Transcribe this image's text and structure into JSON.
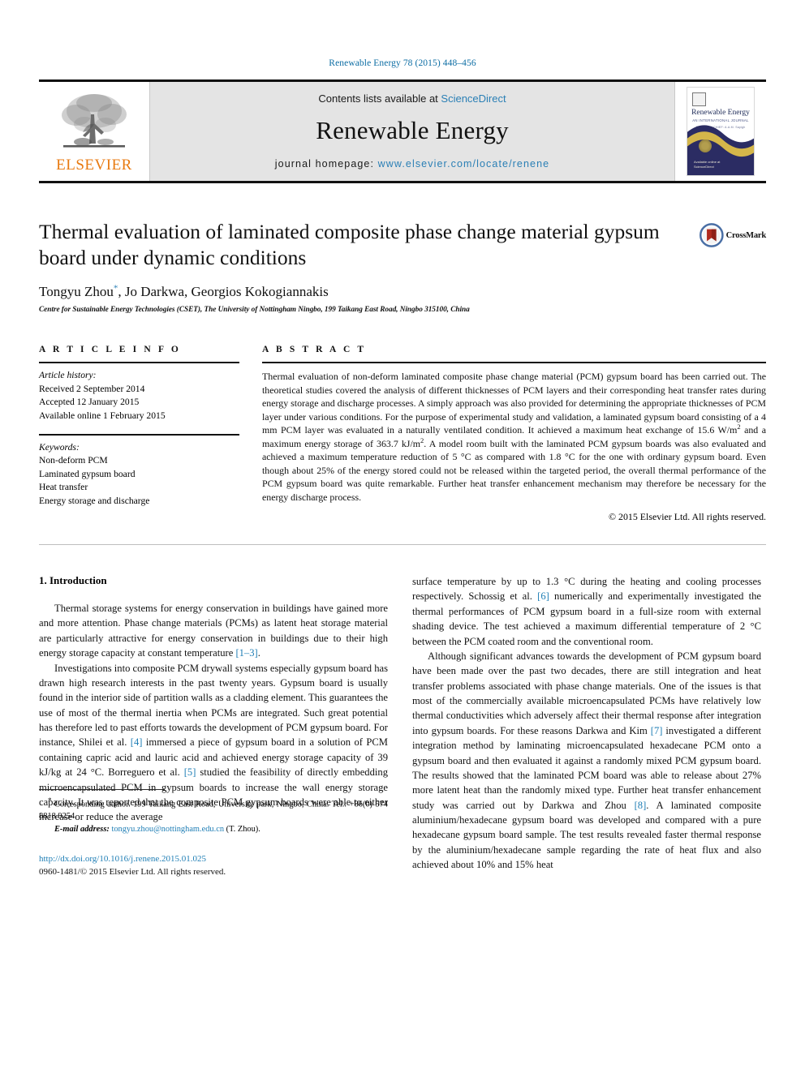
{
  "running_head": "Renewable Energy 78 (2015) 448–456",
  "masthead": {
    "publisher_logo_text": "ELSEVIER",
    "contents_prefix": "Contents lists available at ",
    "contents_link": "ScienceDirect",
    "journal_title": "Renewable Energy",
    "homepage_prefix": "journal homepage: ",
    "homepage_url": "www.elsevier.com/locate/renene",
    "cover": {
      "name": "Renewable Energy",
      "subtitle": "AN INTERNATIONAL JOURNAL",
      "subtitle2": "EDITOR-IN-CHIEF: A.A.M. Sayigh",
      "footer": "Available online at\nScienceDirect"
    }
  },
  "article": {
    "title": "Thermal evaluation of laminated composite phase change material gypsum board under dynamic conditions",
    "authors": "Tongyu Zhou, Jo Darkwa, Georgios Kokogiannakis",
    "affiliation": "Centre for Sustainable Energy Technologies (CSET), The University of Nottingham Ningbo, 199 Taikang East Road, Ningbo 315100, China",
    "crossmark_label": "CrossMark"
  },
  "article_info": {
    "heading": "A R T I C L E   I N F O",
    "history_label": "Article history:",
    "history": [
      "Received 2 September 2014",
      "Accepted 12 January 2015",
      "Available online 1 February 2015"
    ],
    "keywords_label": "Keywords:",
    "keywords": [
      "Non-deform PCM",
      "Laminated gypsum board",
      "Heat transfer",
      "Energy storage and discharge"
    ]
  },
  "abstract": {
    "heading": "A B S T R A C T",
    "part1": "Thermal evaluation of non-deform laminated composite phase change material (PCM) gypsum board has been carried out. The theoretical studies covered the analysis of different thicknesses of PCM layers and their corresponding heat transfer rates during energy storage and discharge processes. A simply approach was also provided for determining the appropriate thicknesses of PCM layer under various conditions. For the purpose of experimental study and validation, a laminated gypsum board consisting of a 4 mm PCM layer was evaluated in a naturally ventilated condition. It achieved a maximum heat exchange of 15.6 W/m",
    "sup1": "2",
    "part2": " and a maximum energy storage of 363.7 kJ/m",
    "sup2": "2",
    "part3": ". A model room built with the laminated PCM gypsum boards was also evaluated and achieved a maximum temperature reduction of 5 °C as compared with 1.8 °C for the one with ordinary gypsum board. Even though about 25% of the energy stored could not be released within the targeted period, the overall thermal performance of the PCM gypsum board was quite remarkable. Further heat transfer enhancement mechanism may therefore be necessary for the energy discharge process.",
    "copyright": "© 2015 Elsevier Ltd. All rights reserved."
  },
  "introduction": {
    "heading": "1. Introduction",
    "left": {
      "p1_a": "Thermal storage systems for energy conservation in buildings have gained more and more attention. Phase change materials (PCMs) as latent heat storage material are particularly attractive for energy conservation in buildings due to their high energy storage capacity at constant temperature ",
      "p1_ref": "[1–3]",
      "p1_b": ".",
      "p2_a": "Investigations into composite PCM drywall systems especially gypsum board has drawn high research interests in the past twenty years. Gypsum board is usually found in the interior side of partition walls as a cladding element. This guarantees the use of most of the thermal inertia when PCMs are integrated. Such great potential has therefore led to past efforts towards the development of PCM gypsum board. For instance, Shilei et al. ",
      "p2_ref1": "[4]",
      "p2_b": " immersed a piece of gypsum board in a solution of PCM containing capric acid and lauric acid and achieved energy storage capacity of 39 kJ/kg at 24 °C. Borreguero et al. ",
      "p2_ref2": "[5]",
      "p2_c": " studied the feasibility of directly embedding microencapsulated PCM in gypsum boards to increase the wall energy storage capacity. It was reported that the composite PCM gypsum boards were able to either increase or reduce the average"
    },
    "right": {
      "p1_a": "surface temperature by up to 1.3 °C during the heating and cooling processes respectively. Schossig et al. ",
      "p1_ref": "[6]",
      "p1_b": " numerically and experimentally investigated the thermal performances of PCM gypsum board in a full-size room with external shading device. The test achieved a maximum differential temperature of 2 °C between the PCM coated room and the conventional room.",
      "p2_a": "Although significant advances towards the development of PCM gypsum board have been made over the past two decades, there are still integration and heat transfer problems associated with phase change materials. One of the issues is that most of the commercially available microencapsulated PCMs have relatively low thermal conductivities which adversely affect their thermal response after integration into gypsum boards. For these reasons Darkwa and Kim ",
      "p2_ref1": "[7]",
      "p2_b": " investigated a different integration method by laminating microencapsulated hexadecane PCM onto a gypsum board and then evaluated it against a randomly mixed PCM gypsum board. The results showed that the laminated PCM board was able to release about 27% more latent heat than the randomly mixed type. Further heat transfer enhancement study was carried out by Darkwa and Zhou ",
      "p2_ref2": "[8]",
      "p2_c": ". A laminated composite aluminium/hexadecane gypsum board was developed and compared with a pure hexadecane gypsum board sample. The test results revealed faster thermal response by the aluminium/hexadecane sample regarding the rate of heat flux and also achieved about 10% and 15% heat"
    }
  },
  "footer": {
    "corresponding_star": "*",
    "corresponding_text": " Corresponding author. 199 Taikang East Road, University park, Ningbo, China. Tel.: +86(0) 574 8818 9254.",
    "email_label": "E-mail address:",
    "email": "tongyu.zhou@nottingham.edu.cn",
    "email_suffix": " (T. Zhou).",
    "doi": "http://dx.doi.org/10.1016/j.renene.2015.01.025",
    "issn": "0960-1481/© 2015 Elsevier Ltd. All rights reserved."
  },
  "colors": {
    "link": "#1f7eb5",
    "elsevier_orange": "#e87a10",
    "masthead_gray": "#e4e4e4",
    "cover_navy": "#2b2c63",
    "cover_gold": "#d4b64a"
  }
}
